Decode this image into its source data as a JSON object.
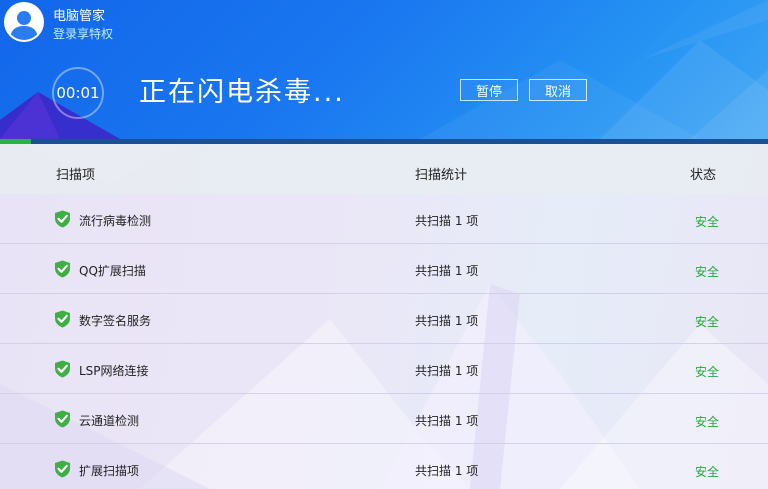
{
  "header": {
    "app_title": "电脑管家",
    "login_link": "登录享特权",
    "timer": "00:01",
    "status_text": "正在闪电杀毒...",
    "pause_label": "暂停",
    "cancel_label": "取消",
    "progress_fraction": 0.04
  },
  "table": {
    "columns": [
      "扫描项",
      "扫描统计",
      "状态"
    ],
    "rows": [
      {
        "name": "流行病毒检测",
        "stat": "共扫描 1 项",
        "status": "安全"
      },
      {
        "name": "QQ扩展扫描",
        "stat": "共扫描 1 项",
        "status": "安全"
      },
      {
        "name": "数字签名服务",
        "stat": "共扫描 1 项",
        "status": "安全"
      },
      {
        "name": "LSP网络连接",
        "stat": "共扫描 1 项",
        "status": "安全"
      },
      {
        "name": "云通道检测",
        "stat": "共扫描 1 项",
        "status": "安全"
      },
      {
        "name": "扩展扫描项",
        "stat": "共扫描 1 项",
        "status": "安全"
      }
    ]
  },
  "colors": {
    "header_blue": "#1a78f0",
    "progress_green": "#27b24a",
    "status_green": "#27a83e"
  },
  "icons": {
    "avatar": "user-avatar-icon",
    "row_status": "green-check-shield-icon"
  }
}
